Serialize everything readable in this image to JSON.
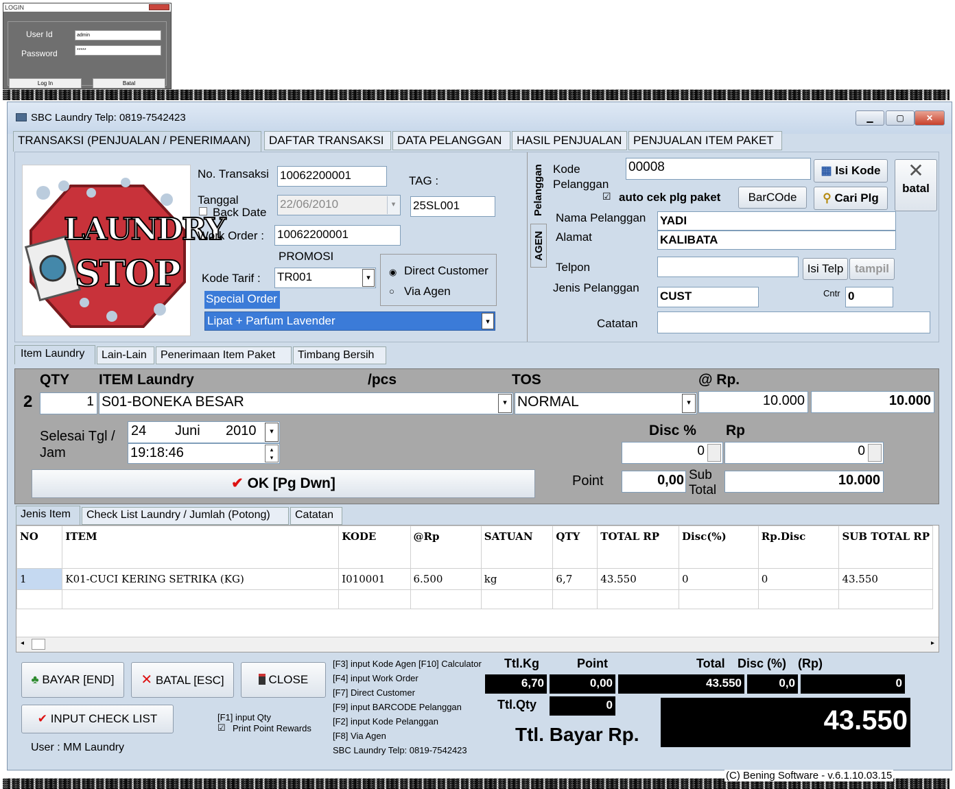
{
  "login": {
    "title": "LOGIN",
    "userid_label": "User Id",
    "userid_value": "admin",
    "password_label": "Password",
    "password_value": "*****",
    "login_btn": "Log In",
    "cancel_btn": "Batal"
  },
  "window": {
    "title": "SBC Laundry   Telp: 0819-7542423",
    "top_tabs": [
      "TRANSAKSI (PENJUALAN / PENERIMAAN)",
      "DAFTAR TRANSAKSI",
      "DATA PELANGGAN",
      "HASIL PENJUALAN",
      "PENJUALAN ITEM PAKET"
    ]
  },
  "logo": {
    "text1": "LAUNDRY",
    "text2": "STOP"
  },
  "transaksi": {
    "no_label": "No. Transaksi",
    "no_value": "10062200001",
    "tag_label": "TAG :",
    "tag_value": "25SL001",
    "tanggal_label": "Tanggal",
    "backdate_label": "Back Date",
    "tanggal_value": "22/06/2010",
    "wo_label": "Work Order :",
    "wo_value": "10062200001",
    "promosi_label": "PROMOSI",
    "kode_tarif_label": "Kode Tarif  :",
    "kode_tarif_value": "TR001",
    "direct_label": "Direct Customer",
    "agen_label": "Via Agen",
    "special_order": "Special Order",
    "special_value": "Lipat + Parfum  Lavender"
  },
  "pelanggan": {
    "side_tab1": "Pelanggan",
    "side_tab2": "AGEN",
    "kode_label": "Kode\nPelanggan",
    "kode_label1": "Kode",
    "kode_label2": "Pelanggan",
    "kode_value": "00008",
    "isi_kode": "Isi Kode",
    "batal": "batal",
    "auto_cek": "auto cek plg paket",
    "barcode": "BarCOde",
    "cari_plg": "Cari Plg",
    "nama_label": "Nama Pelanggan",
    "nama_value": "YADI",
    "alamat_label": "Alamat",
    "alamat_value": "KALIBATA",
    "telpon_label": "Telpon",
    "telpon_value": "",
    "isi_telp": "Isi Telp",
    "tampil": "tampil",
    "jenis_label": "Jenis Pelanggan",
    "jenis_value": "CUST",
    "cntr_label": "Cntr",
    "cntr_value": "0",
    "catatan_label": "Catatan",
    "catatan_value": ""
  },
  "item_tabs": [
    "Item Laundry",
    "Lain-Lain",
    "Penerimaan Item Paket",
    "Timbang Bersih"
  ],
  "item": {
    "h_qty": "QTY",
    "h_item": "ITEM Laundry",
    "h_pcs": "/pcs",
    "h_tos": "TOS",
    "h_rp": "@ Rp.",
    "row_no": "2",
    "qty": "1",
    "item_value": "S01-BONEKA BESAR",
    "tos_value": "NORMAL",
    "price": "10.000",
    "total": "10.000",
    "selesai_label": "Selesai Tgl /\nJam",
    "selesai_l1": "Selesai Tgl /",
    "selesai_l2": "Jam",
    "day": "24",
    "month": "Juni",
    "year": "2010",
    "time": "19:18:46",
    "disc_label": "Disc %",
    "rp_label": "Rp",
    "disc_pct": "0",
    "disc_rp": "0",
    "ok_btn": "OK [Pg Dwn]",
    "point_label": "Point",
    "point_value": "0,00",
    "subtotal_l1": "Sub",
    "subtotal_l2": "Total",
    "subtotal_value": "10.000"
  },
  "list_tabs": [
    "Jenis Item",
    "Check List Laundry / Jumlah (Potong)",
    "Catatan"
  ],
  "grid": {
    "headers": [
      "NO",
      "ITEM",
      "KODE",
      "@Rp",
      "SATUAN",
      "QTY",
      "TOTAL RP",
      "Disc(%)",
      "Rp.Disc",
      "SUB TOTAL RP"
    ],
    "rows": [
      [
        "1",
        "K01-CUCI KERING SETRIKA (KG)",
        "I010001",
        "6.500",
        "kg",
        "6,7",
        "43.550",
        "0",
        "0",
        "43.550"
      ]
    ]
  },
  "bottom": {
    "bayar": "BAYAR [END]",
    "batal": "BATAL [ESC]",
    "close": "CLOSE",
    "input_check": "INPUT CHECK LIST",
    "f1_qty": "[F1] input Qty",
    "print_point": "Print Point Rewards",
    "user": "User : MM Laundry",
    "shortcuts": [
      "[F3] input Kode Agen [F10] Calculator",
      "[F4] input Work Order",
      "[F7] Direct Customer",
      "[F9] input BARCODE Pelanggan",
      "[F2] input Kode Pelanggan",
      "[F8] Via Agen",
      "SBC Laundry  Telp: 0819-7542423"
    ],
    "ttl_kg_label": "Ttl.Kg",
    "point_label": "Point",
    "total_label": "Total",
    "disc_label": "Disc (%)",
    "rp_label": "(Rp)",
    "ttl_kg": "6,70",
    "point": "0,00",
    "total": "43.550",
    "disc_pct": "0,0",
    "disc_rp": "0",
    "ttl_qty_label": "Ttl.Qty",
    "ttl_qty": "0",
    "ttl_bayar_label": "Ttl. Bayar Rp.",
    "ttl_bayar": "43.550"
  },
  "status": {
    "copyright": "(C) Bening Software  - v.6.1.10.03.15"
  }
}
